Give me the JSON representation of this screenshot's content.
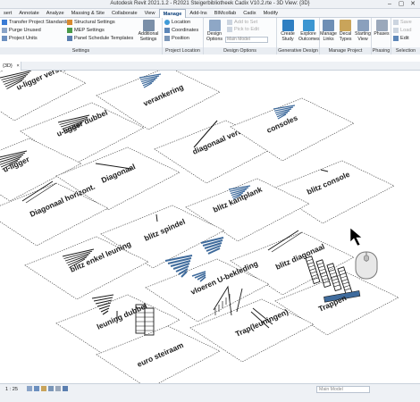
{
  "window": {
    "title": "Autodesk Revit 2021.1.2 - R2021  Steigerbibliotheek Cadix V10.2.rte - 3D View: {3D}",
    "controls": [
      "–",
      "▢",
      "✕"
    ]
  },
  "ribbon_tabs": [
    "sert",
    "Annotate",
    "Analyze",
    "Massing & Site",
    "Collaborate",
    "View",
    "Manage",
    "Add-Ins",
    "BIMcollab",
    "Cadix",
    "Modify"
  ],
  "active_tab": "Manage",
  "ribbon": {
    "settings": {
      "caption": "Settings",
      "items": [
        "Transfer Project Standards",
        "Purge Unused",
        "Project Units"
      ],
      "col2": [
        "Structural Settings",
        "MEP Settings",
        "Panel Schedule Templates"
      ],
      "additional": "Additional Settings"
    },
    "project_location": {
      "caption": "Project Location",
      "items": [
        "Location",
        "Coordinates",
        "Position"
      ]
    },
    "design_options": {
      "caption": "Design Options",
      "button": "Design Options",
      "add_to_set": "Add to Set",
      "pick_to_edit": "Pick to Edit",
      "main_model": "Main Model"
    },
    "generative_design": {
      "caption": "Generative Design",
      "buttons": [
        "Create Study",
        "Explore Outcomes"
      ]
    },
    "manage_project": {
      "caption": "Manage Project",
      "buttons": [
        "Manage Links",
        "Decal Types",
        "Starting View"
      ]
    },
    "phasing": {
      "caption": "Phasing",
      "button": "Phases"
    },
    "selection": {
      "caption": "Selection",
      "items": [
        "Save",
        "Load",
        "Edit"
      ]
    }
  },
  "view_tab": "{3D}",
  "families": [
    "u-ligger verstijving",
    "verankering",
    "u-ligger dubbel",
    "diagonaal verticaal",
    "consoles",
    "u-ligger",
    "Diagonaal",
    "blitz console",
    "Diagonaal horizont.",
    "blitz kantplank",
    "blitz spindel",
    "blitz diagonaal",
    "blitz enkel leuning",
    "vloeren U-bekleding",
    "leuning dubbel",
    "Trappen",
    "Trap(leuningen)",
    "euro steiraam"
  ],
  "status": {
    "scale": "1 : 25",
    "model": "Main Model"
  },
  "colors": {
    "accent": "#2b6cb0",
    "line": "#1a1a1a",
    "blue_elem": "#3f6b9c"
  }
}
